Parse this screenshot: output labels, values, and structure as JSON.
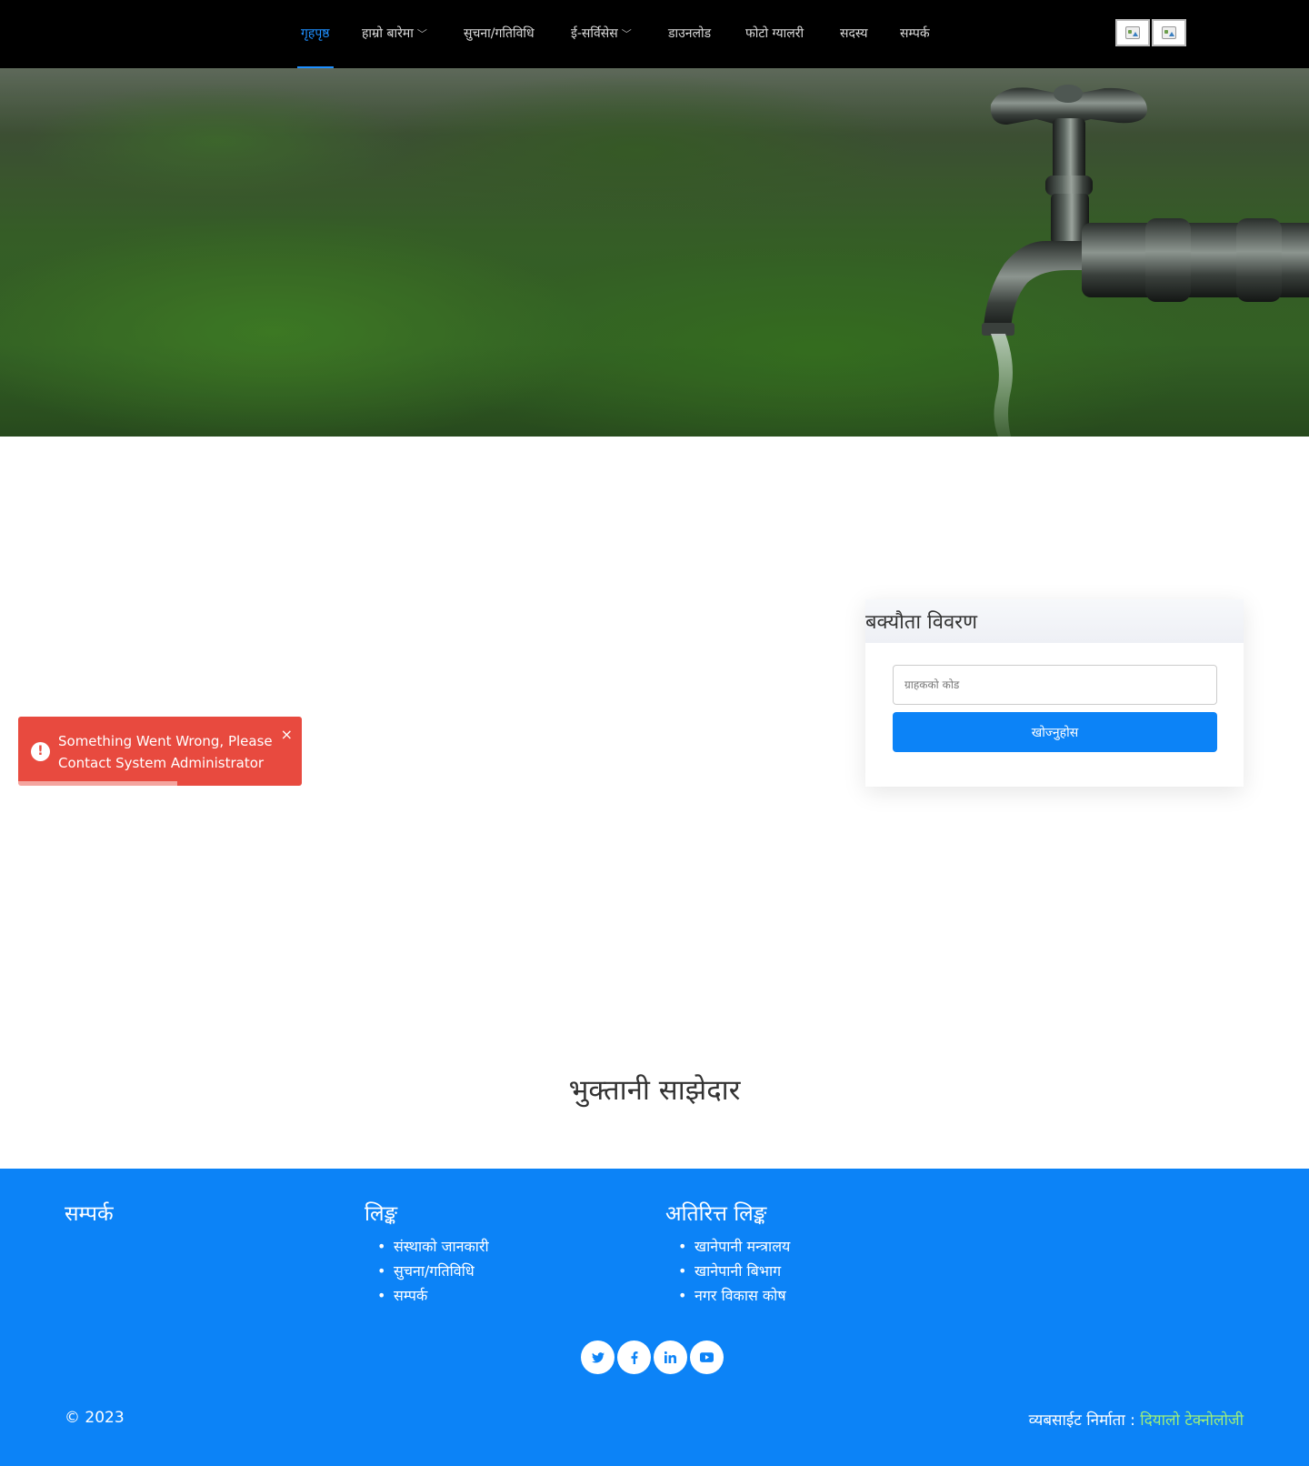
{
  "nav": {
    "items": [
      {
        "label": "गृहपृष्ठ",
        "dropdown": false,
        "active": true
      },
      {
        "label": "हाम्रो बारेमा",
        "dropdown": true
      },
      {
        "label": "सुचना/गतिविधि",
        "dropdown": false
      },
      {
        "label": "ई-सर्विसेस",
        "dropdown": true
      },
      {
        "label": "डाउनलोड",
        "dropdown": false
      },
      {
        "label": "फोटो ग्यालरी",
        "dropdown": false
      },
      {
        "label": "सदस्य",
        "dropdown": false
      },
      {
        "label": "सम्पर्क",
        "dropdown": false
      }
    ],
    "caret": "﹀",
    "active_color": "#1e8fff"
  },
  "due": {
    "title": "बक्यौता विवरण",
    "placeholder": "ग्राहकको कोड",
    "button": "खोज्नुहोस"
  },
  "toast": {
    "message": "Something Went Wrong, Please Contact System Administrator",
    "icon": "!",
    "close": "×",
    "progress": 0.56,
    "color": "#e84a3f"
  },
  "partner": {
    "title": "भुक्तानी साझेदार"
  },
  "footer": {
    "contact_title": "सम्पर्क",
    "links_title": "लिङ्क",
    "links": [
      "संस्थाको जानकारी",
      "सुचना/गतिविधि",
      "सम्पर्क"
    ],
    "extra_title": "अतिरित्त लिङ्क",
    "extra_links": [
      "खानेपानी मन्त्रालय",
      "खानेपानी बिभाग",
      "नगर विकास कोष"
    ],
    "social_icons": [
      "twitter-icon",
      "facebook-icon",
      "linkedin-icon",
      "youtube-icon"
    ],
    "copyright": "© 2023",
    "credit_label": "व्यबसाईट निर्माता :",
    "credit_link": "दियालो टेक्नोलोजी",
    "bg_color": "#0c83f7",
    "link_color": "#9ef07a"
  }
}
